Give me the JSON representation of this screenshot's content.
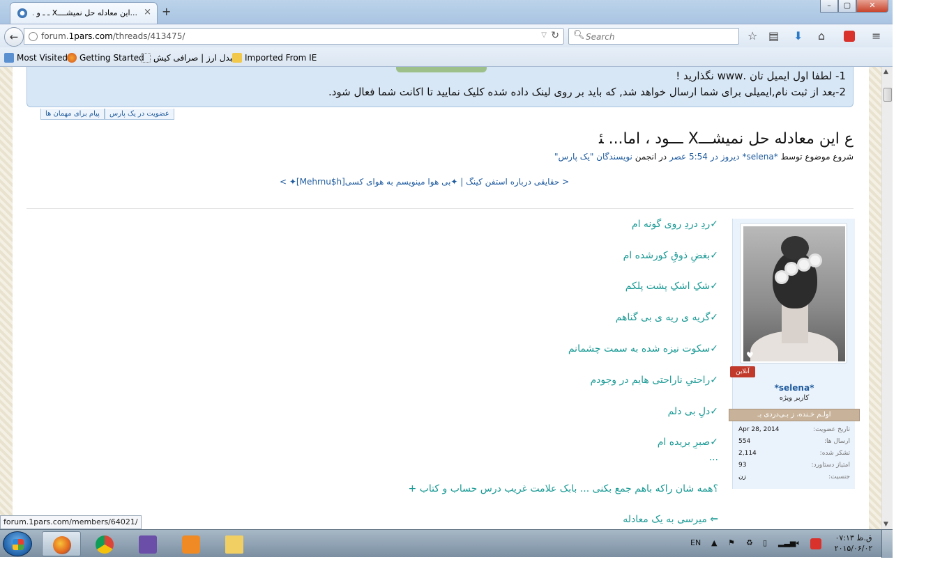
{
  "browser": {
    "tab_title": "...این معادله حل نمیشــــX ـ ـ‌ و ...",
    "newtab": "+",
    "tab_close": "×",
    "url_host": "forum.",
    "url_domain": "1pars.com",
    "url_path": "/threads/413475/",
    "search_placeholder": "Search",
    "bookmarks": [
      "Most Visited",
      "Getting Started",
      "مبدل ارز | صرافی کیش",
      "Imported From IE"
    ]
  },
  "notice": {
    "line1": "1- لطفا اول ایمیل تان .www نگذارید !",
    "line2": "2-بعد از ثبت نام,ایمیلی برای شما ارسال خواهد شد, که باید بر روی لینک داده شده کلیک نمایید تا اکانت شما فعال شود."
  },
  "subtabs": [
    "عضویت در یک پارس",
    "پیام برای مهمان ها"
  ],
  "thread": {
    "title": "ﻉ این معادله حل نمیشـــX ـــود ، اما... ﺌ",
    "starter_prefix": "شروع موضوع توسط",
    "starter_user": "*selena*",
    "starter_time": "دیروز در 5:54 عصر",
    "starter_forum_prefix": "در انجمن",
    "starter_forum": "نویسندگان \"یک پارس\"",
    "prevnext": "< حقایقی درباره استفن کینگ | ✦بی هوا مینویسم به هوای کسی[Mehrnu$h]✦ >"
  },
  "post_lines": [
    "✓ردِ دردِ روی گونه ام",
    "✓بغضِ ذوقِ کورشده ام",
    "✓شکِ اشکِ پشت پلکم",
    "✓گریه ی ریه ی بی گناهم",
    "✓سکوت نیزه شده به سمت چشمانم",
    "✓راحتیِ ناراحتی هایم در وجودم",
    "✓دلِ بی دلم",
    "✓صبرِ بریده ام",
    "...",
    "؟همه شان راکه باهم جمع بکنی ... بابک علامت غریب درس حساب و کتاب +",
    "⇐ میرسی به یک معادله"
  ],
  "member": {
    "badge": "آنلاین",
    "name": "*selena*",
    "title": "کاربر ویژه",
    "ribbon": "اولـم خـنده، ز بـی‌دردی بـ",
    "stats": [
      {
        "k": "تاریخ عضویت:",
        "v": "Apr 28, 2014"
      },
      {
        "k": "ارسال ها:",
        "v": "554"
      },
      {
        "k": "تشکر شده:",
        "v": "2,114"
      },
      {
        "k": "امتیاز دستاورد:",
        "v": "93"
      },
      {
        "k": "جنسیت:",
        "v": "زن"
      }
    ]
  },
  "status_url": "forum.1pars.com/members/64021/",
  "taskbar": {
    "lang": "EN",
    "time": "ق.ظ ۰۷:۱۳",
    "date": "۲۰۱۵/۰۶/۰۲"
  },
  "colors": {
    "post_text": "#1a9a95",
    "link": "#1d5a9e",
    "notice_bg": "#d8e7f6"
  }
}
